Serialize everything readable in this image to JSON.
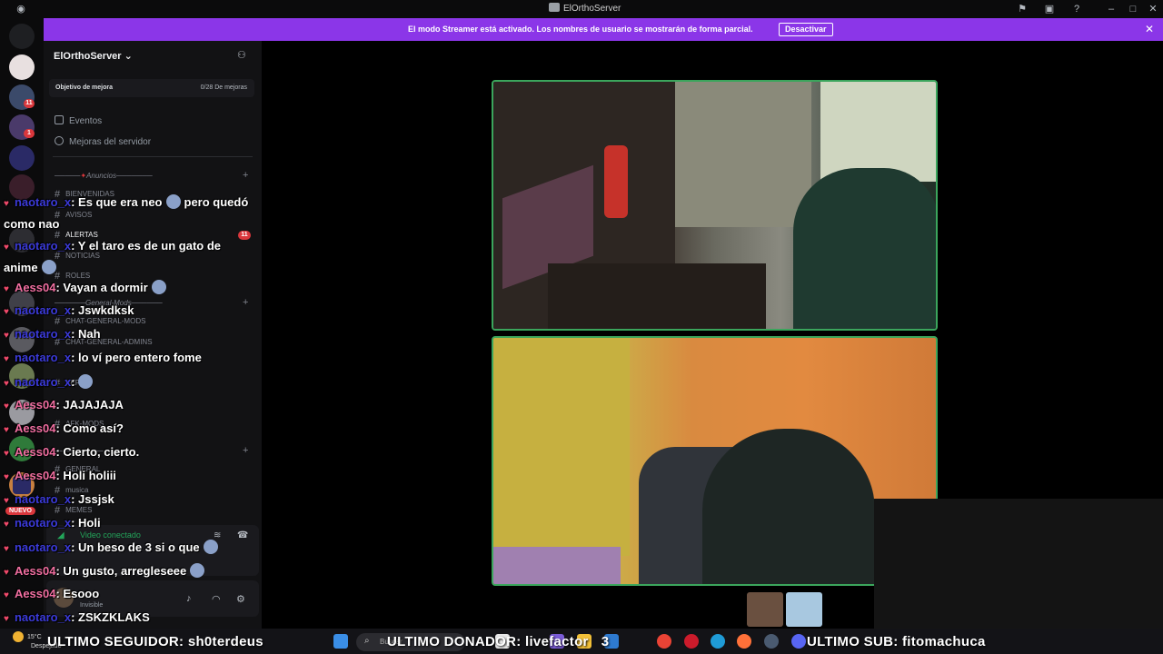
{
  "window": {
    "title": "ElOrthoServer"
  },
  "banner": {
    "text": "El modo Streamer está activado. Los nombres de usuario se mostrarán de forma parcial.",
    "button": "Desactivar"
  },
  "rail": {
    "badges": [
      "11",
      "1"
    ]
  },
  "sidebar": {
    "server_name": "ElOrthoServer",
    "goal_label": "Objetivo de mejora",
    "goal_value": "0/28 De mejoras",
    "links": [
      "Eventos",
      "Mejoras del servidor"
    ],
    "categories": [
      "Anuncios",
      "General-Mods"
    ],
    "channels": [
      "bienvenidas",
      "avisos",
      "alertas",
      "noticias",
      "roles",
      "chat-general-mods",
      "chat-general-admins",
      "pera",
      "afk-mods",
      "general",
      "musica",
      "memes"
    ],
    "alert_badge": "11",
    "new_badge": "NUEVO",
    "voice_status": "Video conectado",
    "user_status": "Invisible"
  },
  "chat": {
    "messages": [
      {
        "user": "naotaro_x",
        "text": ": Es que era neo",
        "tail": "pero quedó como nao",
        "color": "blue"
      },
      {
        "user": "naotaro_x",
        "text": ": Y el taro es de un gato de anime",
        "tail": "",
        "color": "blue"
      },
      {
        "user": "Aess04",
        "text": ": Vayan a dormir",
        "tail": "",
        "color": "pink"
      },
      {
        "user": "naotaro_x",
        "text": ": Jswkdksk",
        "tail": "",
        "color": "blue"
      },
      {
        "user": "naotaro_x",
        "text": ": Nah",
        "tail": "",
        "color": "blue"
      },
      {
        "user": "naotaro_x",
        "text": ": lo ví pero entero fome",
        "tail": "",
        "color": "blue"
      },
      {
        "user": "naotaro_x",
        "text": ":",
        "tail": "",
        "color": "blue"
      },
      {
        "user": "Aess04",
        "text": ": JAJAJAJA",
        "tail": "",
        "color": "pink"
      },
      {
        "user": "Aess04",
        "text": ": Como así?",
        "tail": "",
        "color": "pink"
      },
      {
        "user": "Aess04",
        "text": ": Cierto, cierto.",
        "tail": "",
        "color": "pink"
      },
      {
        "user": "Aess04",
        "text": ": Holi holiii",
        "tail": "",
        "color": "pink"
      },
      {
        "user": "naotaro_x",
        "text": ": Jssjsk",
        "tail": "",
        "color": "blue"
      },
      {
        "user": "naotaro_x",
        "text": ": Holi",
        "tail": "",
        "color": "blue"
      },
      {
        "user": "naotaro_x",
        "text": ": Un beso de 3 si o que",
        "tail": "",
        "color": "blue"
      },
      {
        "user": "Aess04",
        "text": ": Un gusto, arregleseee",
        "tail": "",
        "color": "pink"
      },
      {
        "user": "Aess04",
        "text": ": Esooo",
        "tail": "",
        "color": "pink"
      },
      {
        "user": "naotaro_x",
        "text": ": ZSKZKLAKS",
        "tail": "",
        "color": "blue"
      }
    ]
  },
  "ticker": {
    "follower": "ULTIMO SEGUIDOR: sh0terdeus",
    "donor": "ULTIMO DONADOR: livefactor",
    "donor_amount": "3",
    "sub": "ULTIMO SUB: fitomachuca"
  },
  "taskbar": {
    "weather_temp": "15°C",
    "weather_desc": "Despejado",
    "search_placeholder": "Buscar"
  },
  "colors": {
    "banner": "#8b36e8",
    "speaking_border": "#3ba55c",
    "heart": "#f04a6b",
    "user_pink": "#f06ea0",
    "user_blue": "#3b3ad8"
  }
}
